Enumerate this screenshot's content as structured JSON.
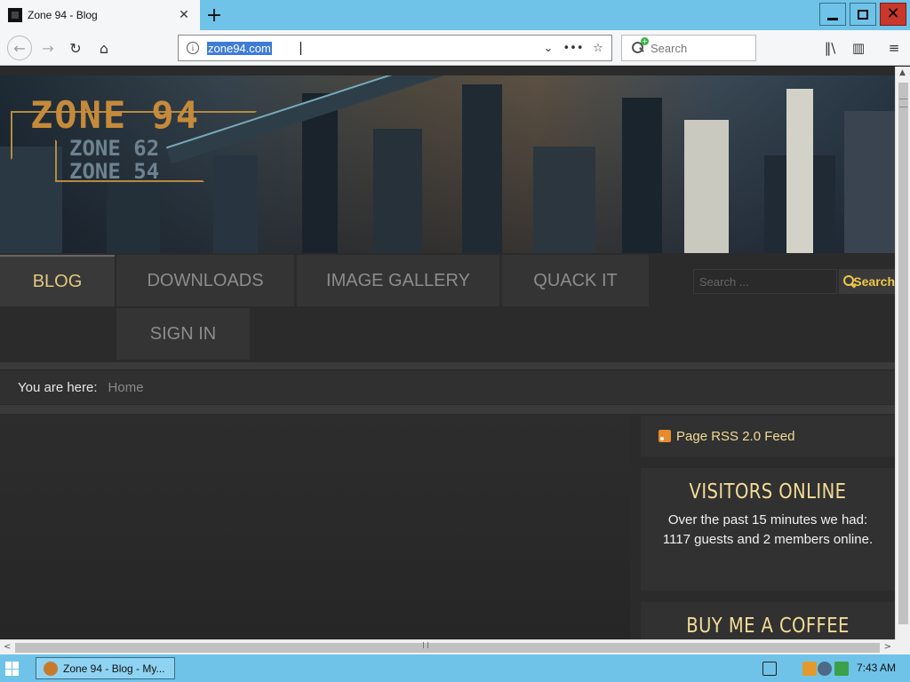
{
  "browser": {
    "tab_title": "Zone 94 - Blog",
    "url": "zone94.com",
    "search_placeholder": "Search"
  },
  "site": {
    "logo_main": "ZONE 94",
    "logo_sub1": "ZONE 62",
    "logo_sub2": "ZONE 54",
    "menu": {
      "blog": "BLOG",
      "downloads": "DOWNLOADS",
      "gallery": "IMAGE GALLERY",
      "quack": "QUACK IT",
      "signin": "SIGN IN"
    },
    "search_placeholder": "Search ...",
    "search_button": "Search",
    "breadcrumb_label": "You are here:",
    "breadcrumb_home": "Home",
    "rss_label": "Page RSS 2.0 Feed",
    "visitors_title": "VISITORS ONLINE",
    "visitors_text": "Over the past 15 minutes we had: 1117 guests and 2 members online.",
    "coffee_title": "BUY ME A COFFEE"
  },
  "taskbar": {
    "task_label": "Zone 94 - Blog - My...",
    "clock": "7:43 AM"
  },
  "colors": {
    "accent": "#f3dc97",
    "active_menu": "#e2c77f",
    "titlebar": "#6fc3e8"
  }
}
